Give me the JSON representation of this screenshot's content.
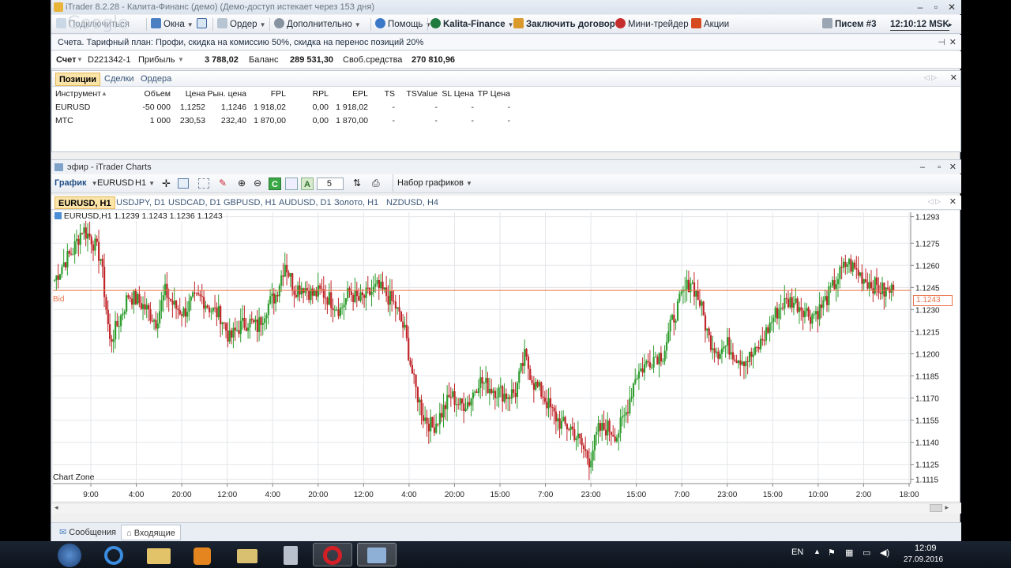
{
  "window": {
    "title": "iTrader 8.2.28 - Калита-Финанс (демо) (Демо-доступ истекает через 153 дня)",
    "watermark": "Google"
  },
  "toolbar": {
    "items": [
      "Подключиться",
      "Окна",
      "Ордер",
      "Дополнительно",
      "Помощь",
      "Kalita-Finance",
      "Заключить договор",
      "Мини-трейдер",
      "Акции"
    ],
    "messages": "Писем #3",
    "clock": "12:10:12 MSK"
  },
  "infobar": {
    "text": "Счета. Тарифный план: Профи, скидка на комиссию 50%, скидка на перенос позиций 20%"
  },
  "account": {
    "label": "Счет",
    "id": "D221342-1",
    "profit_label": "Прибыль",
    "profit": "3 788,02",
    "balance_label": "Баланс",
    "balance": "289 531,30",
    "free_label": "Своб.средства",
    "free": "270 810,96"
  },
  "positions": {
    "tabs": [
      "Позиции",
      "Сделки",
      "Ордера"
    ],
    "columns": [
      "Инструмент",
      "Объем",
      "Цена",
      "Рын. цена",
      "FPL",
      "RPL",
      "EPL",
      "TS",
      "TSValue",
      "SL Цена",
      "TP Цена"
    ],
    "rows": [
      [
        "EURUSD",
        "-50 000",
        "1,1252",
        "1,1246",
        "1 918,02",
        "0,00",
        "1 918,02",
        "-",
        "-",
        "-",
        "-"
      ],
      [
        "MTC",
        "1 000",
        "230,53",
        "232,40",
        "1 870,00",
        "0,00",
        "1 870,00",
        "-",
        "-",
        "-",
        "-"
      ]
    ]
  },
  "chart_window": {
    "title": "эфир - iTrader Charts",
    "toolbar_label": "График",
    "symbol": "EURUSD",
    "timeframe": "H1",
    "spin_value": "5",
    "sets_label": "Набор графиков",
    "tabs": [
      "EURUSD, H1",
      "USDJPY, D1",
      "USDCAD, D1",
      "GBPUSD, H1",
      "AUDUSD, D1",
      "Золото, H1",
      "NZDUSD, H4"
    ],
    "legend": "EURUSD,H1  1.1239  1.1243  1.1236  1.1243",
    "zone_label": "Chart Zone",
    "bid_label": "Bid",
    "bid_value": "1.1243",
    "bid_color": "#e8734a",
    "up_color": "#2e9d2e",
    "down_color": "#c0262a"
  },
  "chart_data": {
    "type": "candlestick",
    "symbol": "EURUSD",
    "timeframe": "H1",
    "last_ohlc": [
      1.1239,
      1.1243,
      1.1236,
      1.1243
    ],
    "y_ticks": [
      "1.1293",
      "1.1275",
      "1.1260",
      "1.1245",
      "1.1230",
      "1.1215",
      "1.1200",
      "1.1185",
      "1.1170",
      "1.1155",
      "1.1140",
      "1.1125",
      "1.1115"
    ],
    "x_ticks": [
      "9:00",
      "4:00",
      "20:00",
      "12:00",
      "4:00",
      "20:00",
      "12:00",
      "4:00",
      "20:00",
      "15:00",
      "7:00",
      "23:00",
      "15:00",
      "7:00",
      "23:00",
      "15:00",
      "10:00",
      "2:00",
      "18:00"
    ],
    "ylim": [
      1.1112,
      1.1296
    ],
    "bid": 1.1243,
    "path_closes": [
      1.125,
      1.1262,
      1.127,
      1.1285,
      1.1278,
      1.1265,
      1.1208,
      1.1222,
      1.124,
      1.1236,
      1.123,
      1.1222,
      1.1242,
      1.1232,
      1.1228,
      1.1236,
      1.1238,
      1.123,
      1.1226,
      1.121,
      1.1218,
      1.1222,
      1.1218,
      1.1232,
      1.124,
      1.1262,
      1.1244,
      1.1246,
      1.124,
      1.1242,
      1.1236,
      1.123,
      1.1242,
      1.1236,
      1.124,
      1.1245,
      1.124,
      1.1232,
      1.1215,
      1.118,
      1.1158,
      1.115,
      1.116,
      1.1172,
      1.1165,
      1.1168,
      1.1182,
      1.1178,
      1.1175,
      1.1172,
      1.1174,
      1.1198,
      1.118,
      1.1172,
      1.116,
      1.1152,
      1.115,
      1.114,
      1.1128,
      1.1148,
      1.115,
      1.1145,
      1.116,
      1.1185,
      1.1192,
      1.1198,
      1.12,
      1.1222,
      1.1238,
      1.125,
      1.1235,
      1.121,
      1.1202,
      1.1206,
      1.1198,
      1.1196,
      1.12,
      1.1212,
      1.1225,
      1.1234,
      1.1236,
      1.1232,
      1.1226,
      1.123,
      1.124,
      1.1252,
      1.1262,
      1.1256,
      1.125,
      1.1246,
      1.1242,
      1.1243
    ]
  }
}
